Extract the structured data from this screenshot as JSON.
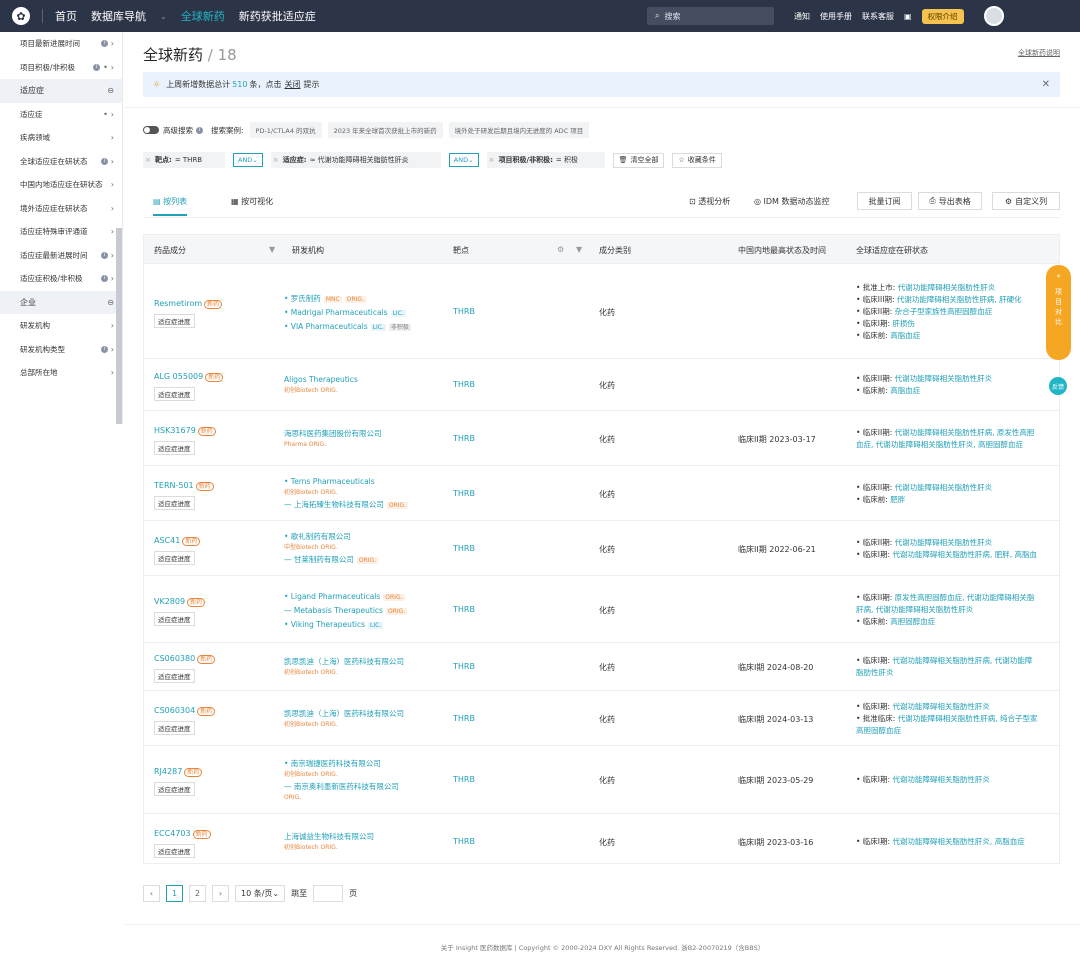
{
  "nav": {
    "items": [
      "首页",
      "数据库导航",
      "全球新药",
      "新药获批适应症"
    ],
    "search": "搜索",
    "right": [
      "通知",
      "使用手册",
      "联系客服"
    ],
    "perm": "权限介绍"
  },
  "sidebar": [
    {
      "label": "项目最新进展时间",
      "type": "item",
      "info": true
    },
    {
      "label": "项目积极/非积极",
      "type": "item",
      "info": true,
      "dot": true
    },
    {
      "label": "适应症",
      "type": "group"
    },
    {
      "label": "适应症",
      "type": "item",
      "dot": true
    },
    {
      "label": "疾病领域",
      "type": "item"
    },
    {
      "label": "全球适应症在研状态",
      "type": "item",
      "info": true
    },
    {
      "label": "中国内地适应症在研状态",
      "type": "item"
    },
    {
      "label": "境外适应症在研状态",
      "type": "item"
    },
    {
      "label": "适应症特殊审评通道",
      "type": "item"
    },
    {
      "label": "适应症最新进展时间",
      "type": "item",
      "info": true
    },
    {
      "label": "适应症积极/非积极",
      "type": "item",
      "info": true
    },
    {
      "label": "企业",
      "type": "group"
    },
    {
      "label": "研发机构",
      "type": "item"
    },
    {
      "label": "研发机构类型",
      "type": "item",
      "info": true
    },
    {
      "label": "总部所在地",
      "type": "item"
    }
  ],
  "page": {
    "title": "全球新药",
    "count": "/ 18",
    "help": "全球新药说明"
  },
  "notice": {
    "pre": "上周新增数据总计",
    "num": "510",
    "mid": "条，点击",
    "link": "关闭",
    "post": "提示"
  },
  "filters": {
    "adv": "高级搜索",
    "cases_label": "搜索案例:",
    "cases": [
      "PD-1/CTLA4 的双抗",
      "2023 年来全球首次获批上市的新药",
      "境外处于研发后期且境内无进度的 ADC 项目"
    ],
    "chips": [
      {
        "key": "靶点:",
        "val": "= THRB"
      },
      {
        "key": "适应症:",
        "val": "≈ 代谢功能障碍相关脂肪性肝炎"
      },
      {
        "key": "项目积极/非积极:",
        "val": "= 积极"
      }
    ],
    "and": "AND",
    "clear": "清空全部",
    "save": "收藏条件"
  },
  "tabs": {
    "list": "按列表",
    "vis": "按可视化",
    "pivot": "透视分析",
    "idm": "IDM 数据动态监控",
    "subscribe": "批量订阅",
    "export": "导出表格",
    "custom": "自定义列"
  },
  "columns": [
    "药品成分",
    "研发机构",
    "靶点",
    "成分类别",
    "中国内地最高状态及时间",
    "全球适应症在研状态"
  ],
  "new_tag": "新药",
  "prog_btn": "适应症进度",
  "rows": [
    {
      "drug": "Resmetirom",
      "orgs": [
        {
          "name": "罗氏制药",
          "tags": [
            "MNC",
            "ORIG."
          ]
        },
        {
          "name": "Madrigal Pharmaceuticals",
          "tags": [
            "LIC."
          ]
        },
        {
          "name": "VIA Pharmaceuticals",
          "tags": [
            "LIC.",
            "非积极"
          ]
        }
      ],
      "target": "THRB",
      "type": "化药",
      "status": "",
      "global": [
        [
          "批准上市:",
          "代谢功能障碍相关脂肪性肝炎"
        ],
        [
          "临床III期:",
          "代谢功能障碍相关脂肪性肝病, 肝硬化"
        ],
        [
          "临床II期:",
          "杂合子型家族性高胆固醇血症"
        ],
        [
          "临床I期:",
          "肝损伤"
        ],
        [
          "临床前:",
          "高脂血症"
        ]
      ]
    },
    {
      "drug": "ALG 055009",
      "orgs": [
        {
          "name": "Aligos Therapeutics",
          "sub": "初创Biotech ORIG."
        }
      ],
      "target": "THRB",
      "type": "化药",
      "status": "",
      "global": [
        [
          "临床II期:",
          "代谢功能障碍相关脂肪性肝炎"
        ],
        [
          "临床前:",
          "高脂血症"
        ]
      ]
    },
    {
      "drug": "HSK31679",
      "orgs": [
        {
          "name": "海思科医药集团股份有限公司",
          "sub": "Pharma ORIG."
        }
      ],
      "target": "THRB",
      "type": "化药",
      "status": "临床II期 2023-03-17",
      "global": [
        [
          "临床II期:",
          "代谢功能障碍相关脂肪性肝病, 原发性高胆"
        ],
        [
          "",
          "血症, 代谢功能障碍相关脂肪性肝炎, 高胆固醇血症"
        ]
      ]
    },
    {
      "drug": "TERN-501",
      "orgs": [
        {
          "name": "Terns Pharmaceuticals",
          "sub": "初创Biotech ORIG."
        },
        {
          "name": "— 上海拓臻生物科技有限公司",
          "tags": [
            "ORIG."
          ]
        }
      ],
      "target": "THRB",
      "type": "化药",
      "status": "",
      "global": [
        [
          "临床II期:",
          "代谢功能障碍相关脂肪性肝炎"
        ],
        [
          "临床前:",
          "肥胖"
        ]
      ]
    },
    {
      "drug": "ASC41",
      "orgs": [
        {
          "name": "歌礼制药有限公司",
          "sub": "中型Biotech ORIG."
        },
        {
          "name": "— 甘莱制药有限公司",
          "tags": [
            "ORIG."
          ]
        }
      ],
      "target": "THRB",
      "type": "化药",
      "status": "临床II期 2022-06-21",
      "global": [
        [
          "临床II期:",
          "代谢功能障碍相关脂肪性肝炎"
        ],
        [
          "临床I期:",
          "代谢功能障碍相关脂肪性肝病, 肥胖, 高脂血"
        ]
      ]
    },
    {
      "drug": "VK2809",
      "orgs": [
        {
          "name": "Ligand Pharmaceuticals",
          "tags": [
            "ORIG."
          ]
        },
        {
          "name": "— Metabasis Therapeutics",
          "tags": [
            "ORIG."
          ]
        },
        {
          "name": "Viking Therapeutics",
          "tags": [
            "LIC."
          ]
        }
      ],
      "target": "THRB",
      "type": "化药",
      "status": "",
      "global": [
        [
          "临床II期:",
          "原发性高胆固醇血症, 代谢功能障碍相关脂"
        ],
        [
          "",
          "肝病, 代谢功能障碍相关脂肪性肝炎"
        ],
        [
          "临床前:",
          "高胆固醇血症"
        ]
      ]
    },
    {
      "drug": "CS060380",
      "orgs": [
        {
          "name": "凯思凯迪（上海）医药科技有限公司",
          "sub": "初创Biotech ORIG."
        }
      ],
      "target": "THRB",
      "type": "化药",
      "status": "临床I期 2024-08-20",
      "global": [
        [
          "临床I期:",
          "代谢功能障碍相关脂肪性肝病, 代谢功能障"
        ],
        [
          "",
          "脂肪性肝炎"
        ]
      ]
    },
    {
      "drug": "CS060304",
      "orgs": [
        {
          "name": "凯思凯迪（上海）医药科技有限公司",
          "sub": "初创Biotech ORIG."
        }
      ],
      "target": "THRB",
      "type": "化药",
      "status": "临床I期 2024-03-13",
      "global": [
        [
          "临床I期:",
          "代谢功能障碍相关脂肪性肝炎"
        ],
        [
          "批准临床:",
          "代谢功能障碍相关脂肪性肝病, 纯合子型家"
        ],
        [
          "",
          "高胆固醇血症"
        ]
      ]
    },
    {
      "drug": "RJ4287",
      "orgs": [
        {
          "name": "南京瑞捷医药科技有限公司",
          "sub": "初创Biotech ORIG."
        },
        {
          "name": "— 南京奥利墨新医药科技有限公司",
          "sub2": "ORIG."
        }
      ],
      "target": "THRB",
      "type": "化药",
      "status": "临床I期 2023-05-29",
      "global": [
        [
          "临床I期:",
          "代谢功能障碍相关脂肪性肝炎"
        ]
      ]
    },
    {
      "drug": "ECC4703",
      "orgs": [
        {
          "name": "上海诚益生物科技有限公司",
          "sub": "初创Biotech ORIG."
        }
      ],
      "target": "THRB",
      "type": "化药",
      "status": "临床I期 2023-03-16",
      "global": [
        [
          "临床I期:",
          "代谢功能障碍相关脂肪性肝炎, 高脂血症"
        ]
      ]
    }
  ],
  "pager": {
    "p1": "1",
    "p2": "2",
    "size": "10 条/页",
    "jump": "跳至",
    "page": "页"
  },
  "footer": "关于 Insight 医药数据库 | Copyright © 2000-2024 DXY All Rights Reserved. 浙B2-20070219（含BBS）",
  "float": {
    "compare": "项目对比",
    "feedback": "反馈"
  }
}
